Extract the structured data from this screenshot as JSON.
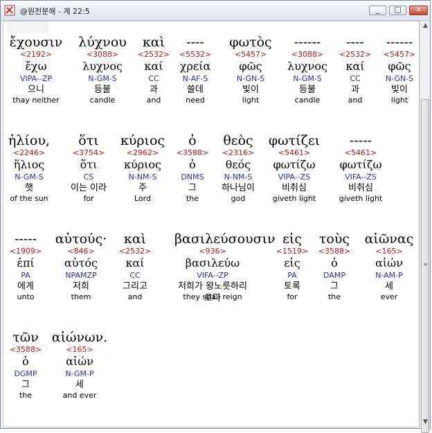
{
  "window": {
    "title": "@원전분해 - 계 22:5",
    "icon": "app-icon"
  },
  "rows": [
    [
      {
        "greek": "ἔχουσιν",
        "strong": "<2192>",
        "lemma": "ἔχω",
        "parse": "VIPA--ZP",
        "kor": "으니",
        "eng": "thay neither"
      },
      {
        "greek": "λύχνου",
        "strong": "<3088>",
        "lemma": "λυχνος",
        "parse": "N-GM-S",
        "kor": "등불",
        "eng": "candle"
      },
      {
        "greek": "καὶ",
        "strong": "<2532>",
        "lemma": "καί",
        "parse": "CC",
        "kor": "과",
        "eng": "and"
      },
      {
        "greek": "----",
        "strong": "<5532>",
        "lemma": "χρεία",
        "parse": "N-AF-S",
        "kor": "쓸데",
        "eng": "need"
      },
      {
        "greek": "φωτὸς",
        "strong": "<5457>",
        "lemma": "φῶς",
        "parse": "N-GN-S",
        "kor": "빛이",
        "eng": "light"
      },
      {
        "greek": "------",
        "strong": "<3088>",
        "lemma": "λυχνος",
        "parse": "N-GM-S",
        "kor": "등불",
        "eng": "candle"
      },
      {
        "greek": "----",
        "strong": "<2532>",
        "lemma": "καί",
        "parse": "CC",
        "kor": "과",
        "eng": "and"
      },
      {
        "greek": "------",
        "strong": "<5457>",
        "lemma": "φῶς",
        "parse": "N-GN-S",
        "kor": "빛이",
        "eng": "light"
      }
    ],
    [
      {
        "greek": "ἡλίου,",
        "strong": "<2246>",
        "lemma": "ἥλιος",
        "parse": "N-GM-S",
        "kor": "햇",
        "eng": "of the sun"
      },
      {
        "greek": "ὅτι",
        "strong": "<3754>",
        "lemma": "ὅτι",
        "parse": "CS",
        "kor": "이는 이라",
        "eng": "for"
      },
      {
        "greek": "κύριος",
        "strong": "<2962>",
        "lemma": "κύριος",
        "parse": "N-NM-S",
        "kor": "주",
        "eng": "Lord"
      },
      {
        "greek": "ὁ",
        "strong": "<3588>",
        "lemma": "ὁ",
        "parse": "DNMS",
        "kor": "그",
        "eng": "the"
      },
      {
        "greek": "θεὸς",
        "strong": "<2316>",
        "lemma": "θεός",
        "parse": "N-NM-S",
        "kor": "하나님이",
        "eng": "god"
      },
      {
        "greek": "φωτίζει",
        "strong": "<5461>",
        "lemma": "φωτίζω",
        "parse": "VIPA--ZS",
        "kor": "비취심",
        "eng": "giveth light"
      },
      {
        "greek": "-----",
        "strong": "<5461>",
        "lemma": "φωτίζω",
        "parse": "VIFA--ZS",
        "kor": "비취심",
        "eng": "giveth light"
      }
    ],
    [
      {
        "greek": "-----",
        "strong": "<1909>",
        "lemma": "ἐπί",
        "parse": "PA",
        "kor": "에게",
        "eng": "unto"
      },
      {
        "greek": "αὐτούς·",
        "strong": "<846>",
        "lemma": "αὐτός",
        "parse": "NPAMZP",
        "kor": "저희",
        "eng": "them"
      },
      {
        "greek": "καὶ",
        "strong": "<2532>",
        "lemma": "καί",
        "parse": "CC",
        "kor": "그리고",
        "eng": "and"
      },
      {
        "greek": "βασιλεύσουσιν",
        "strong": "<936>",
        "lemma": "βασιλεύω",
        "parse": "VIFA--ZP",
        "kor": "저희가 왕노릇하리로다",
        "eng": "they shall reign"
      },
      {
        "greek": "εἰς",
        "strong": "<1519>",
        "lemma": "εἰς",
        "parse": "PA",
        "kor": "토록",
        "eng": "for"
      },
      {
        "greek": "τοὺς",
        "strong": "<3588>",
        "lemma": "ὁ",
        "parse": "DAMP",
        "kor": "그",
        "eng": "the"
      },
      {
        "greek": "αἰῶνας",
        "strong": "<165>",
        "lemma": "αἰών",
        "parse": "N-AM-P",
        "kor": "세",
        "eng": "ever"
      }
    ],
    [
      {
        "greek": "τῶν",
        "strong": "<3588>",
        "lemma": "ὁ",
        "parse": "DGMP",
        "kor": "그",
        "eng": "the"
      },
      {
        "greek": "αἰώνων.",
        "strong": "<165>",
        "lemma": "αἰών",
        "parse": "N-GM-P",
        "kor": "세",
        "eng": "and ever"
      }
    ]
  ]
}
